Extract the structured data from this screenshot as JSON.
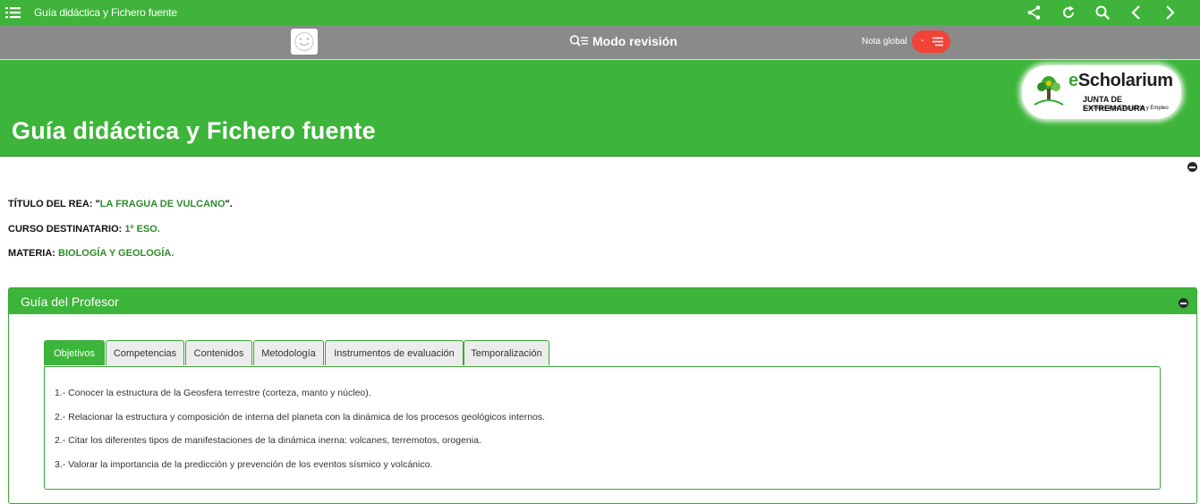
{
  "topbar": {
    "title": "Guía didáctica y Fichero fuente"
  },
  "review": {
    "mode_label": "Modo revisión",
    "nota_label": "Nota global",
    "nota_value": "-"
  },
  "header": {
    "title": "Guía didáctica y Fichero fuente"
  },
  "logo": {
    "brand_e": "e",
    "brand_rest": "Scholarium",
    "junta": "JUNTA DE EXTREMADURA",
    "consejeria": "Consejería de Educación y Empleo"
  },
  "info": {
    "titulo_label": "TÍTULO DEL REA: \"",
    "titulo_value": "LA FRAGUA DE VULCANO",
    "titulo_end": "\".",
    "curso_label": "CURSO DESTINATARIO: ",
    "curso_value": "1º ESO.",
    "materia_label": "MATERIA: ",
    "materia_value": "BIOLOGÍA Y GEOLOGÍA."
  },
  "panel": {
    "title": "Guía del Profesor"
  },
  "tabs": [
    "Objetivos",
    "Competencias",
    "Contenidos",
    "Metodología",
    "Instrumentos de evaluación",
    "Temporalización"
  ],
  "objectives": [
    "1.- Conocer la estructura de la Geosfera terrestre (corteza, manto y núcleo).",
    "2.- Relacionar la estructura y composición de interna del planeta con la dinámica de los procesos geológicos internos.",
    "2.- Citar los diferentes tipos de manifestaciones de la dinámica inerna: volcanes, terremotos, orogenia.",
    "3.- Valorar la importancia de la predicción y prevención de los eventos sísmico y volcánico."
  ],
  "colors": {
    "green": "#3db53a",
    "dark_green": "#2e8b2a",
    "gray_bar": "#8a8a8a",
    "red": "#f04438"
  },
  "icons": [
    "menu-icon",
    "share-icon",
    "refresh-icon",
    "search-icon",
    "chevron-left-icon",
    "chevron-right-icon",
    "smiley-icon",
    "review-search-icon",
    "lines-icon",
    "collapse-icon"
  ]
}
